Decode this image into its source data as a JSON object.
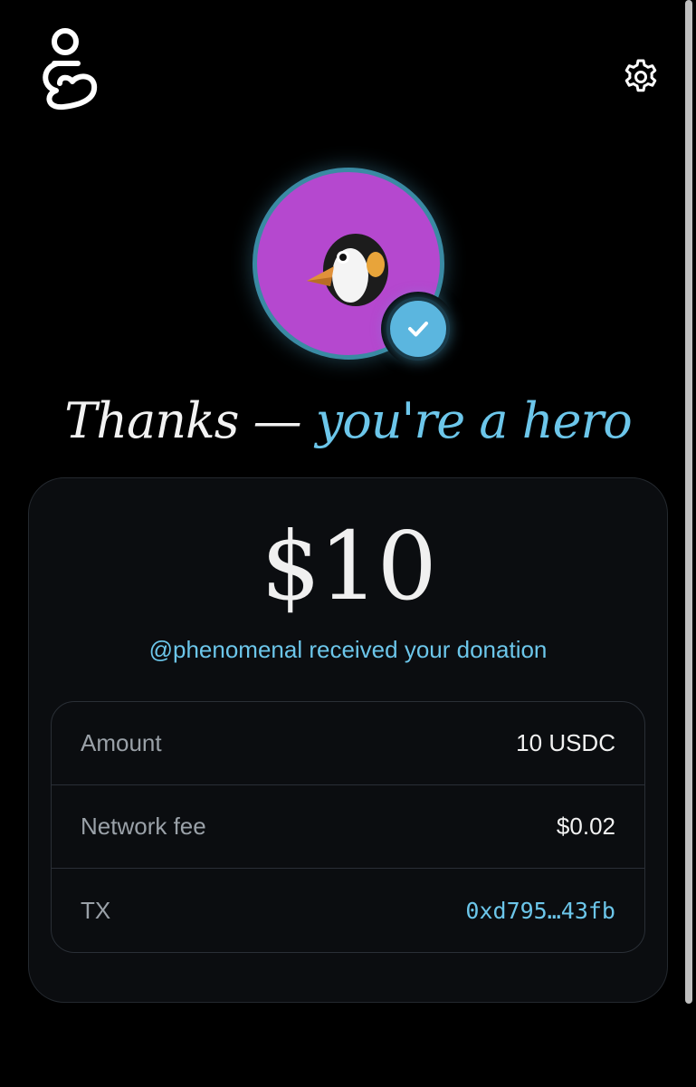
{
  "header": {
    "logo_icon": "hand-heart-logo",
    "settings_icon": "gear-icon"
  },
  "avatar": {
    "emoji": "penguin",
    "badge_icon": "check-icon",
    "background_color": "#b548cf",
    "badge_color": "#5bb6df"
  },
  "headline": {
    "part1": "Thanks — ",
    "part2": "you're a hero"
  },
  "donation": {
    "amount_display": "$10",
    "recipient_message": "@phenomenal received your donation"
  },
  "details": {
    "rows": [
      {
        "label": "Amount",
        "value": "10 USDC"
      },
      {
        "label": "Network fee",
        "value": "$0.02"
      },
      {
        "label": "TX",
        "value": "0xd795…43fb"
      }
    ]
  },
  "colors": {
    "accent": "#6cc6ea",
    "background": "#000000",
    "card": "#0b0d10"
  }
}
